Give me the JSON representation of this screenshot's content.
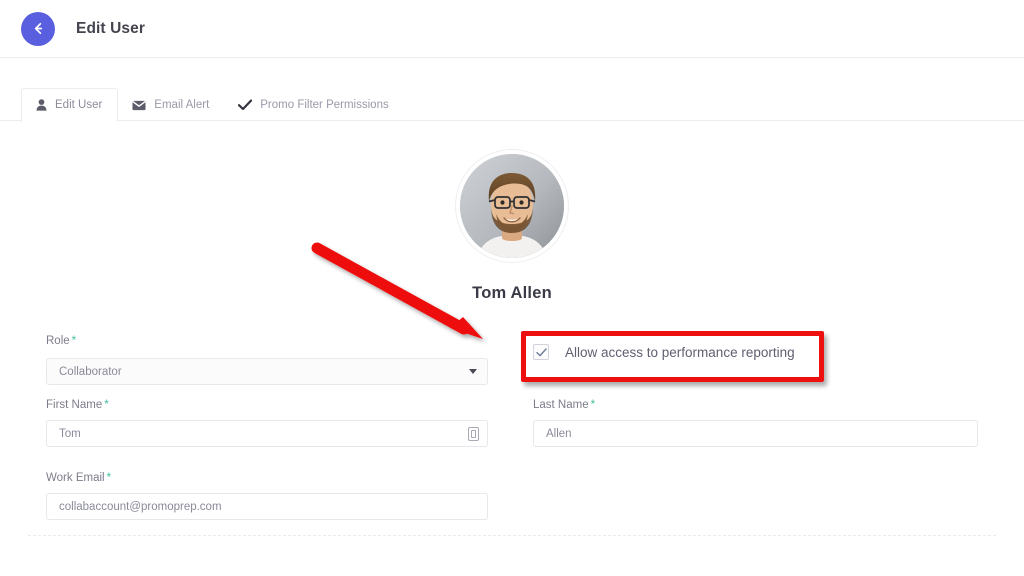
{
  "header": {
    "title": "Edit User",
    "back_icon": "arrow-left-icon",
    "back_color": "#5a5fe0"
  },
  "tabs": [
    {
      "label": "Edit User",
      "icon": "user-icon",
      "active": true
    },
    {
      "label": "Email Alert",
      "icon": "envelope-icon",
      "active": false
    },
    {
      "label": "Promo Filter Permissions",
      "icon": "check-icon",
      "active": false
    }
  ],
  "profile": {
    "name": "Tom Allen",
    "avatar_alt": "user-photo"
  },
  "form": {
    "role": {
      "label": "Role",
      "required": "*",
      "value": "Collaborator",
      "caret_icon": "chevron-down-icon"
    },
    "first_name": {
      "label": "First Name",
      "required": "*",
      "value": "Tom",
      "trailing_icon": "autofill-icon"
    },
    "last_name": {
      "label": "Last Name",
      "required": "*",
      "value": "Allen"
    },
    "work_email": {
      "label": "Work Email",
      "required": "*",
      "value": "collabaccount@promoprep.com"
    },
    "performance_reporting": {
      "label": "Allow access to performance reporting",
      "checked": true,
      "check_icon": "checkmark-icon"
    }
  },
  "annotations": {
    "color": "#ee0f0f",
    "highlight_target": "Allow access to performance reporting",
    "arrow": "red-arrow-pointing-to-checkbox"
  }
}
